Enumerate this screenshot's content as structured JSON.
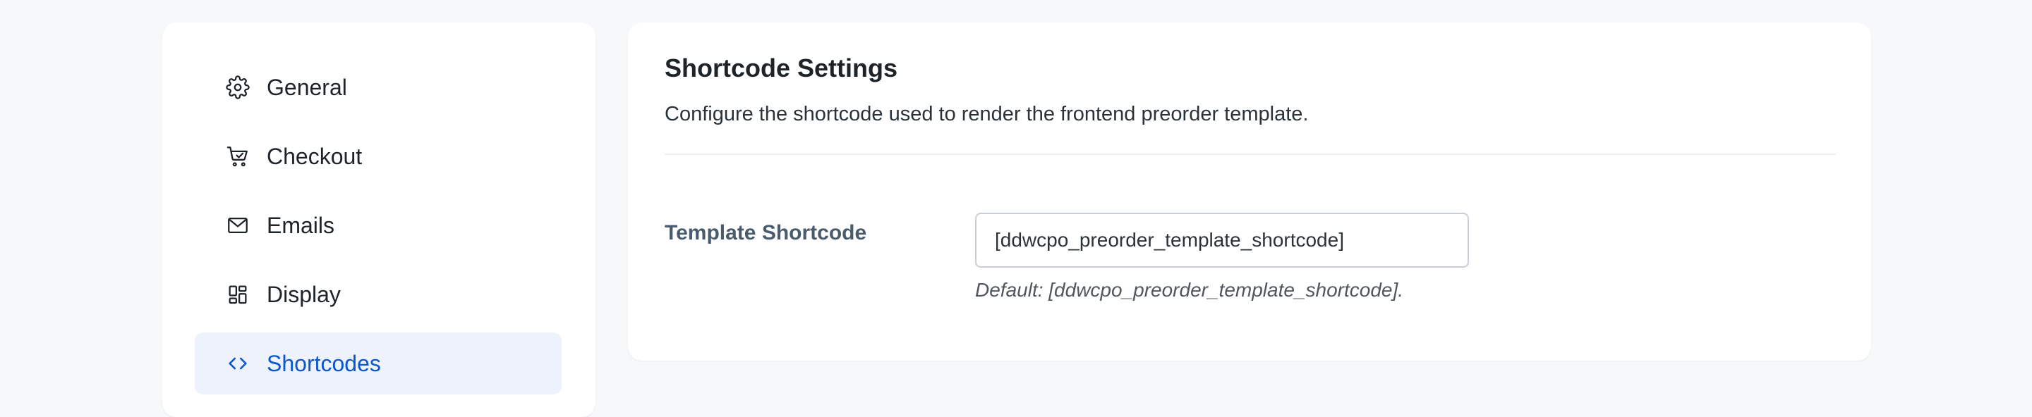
{
  "sidebar": {
    "items": [
      {
        "label": "General",
        "icon": "gear-icon",
        "active": false
      },
      {
        "label": "Checkout",
        "icon": "cart-icon",
        "active": false
      },
      {
        "label": "Emails",
        "icon": "mail-icon",
        "active": false
      },
      {
        "label": "Display",
        "icon": "layout-grid-icon",
        "active": false
      },
      {
        "label": "Shortcodes",
        "icon": "code-icon",
        "active": true
      }
    ]
  },
  "panel": {
    "title": "Shortcode Settings",
    "description": "Configure the shortcode used to render the frontend preorder template.",
    "fields": [
      {
        "label": "Template Shortcode",
        "value": "[ddwcpo_preorder_template_shortcode]",
        "help": "Default: [ddwcpo_preorder_template_shortcode]."
      }
    ]
  },
  "colors": {
    "accent": "#0b57d0",
    "active_bg": "#edf2fd",
    "page_bg": "#f7f8fa",
    "label": "#4b5b6e"
  }
}
